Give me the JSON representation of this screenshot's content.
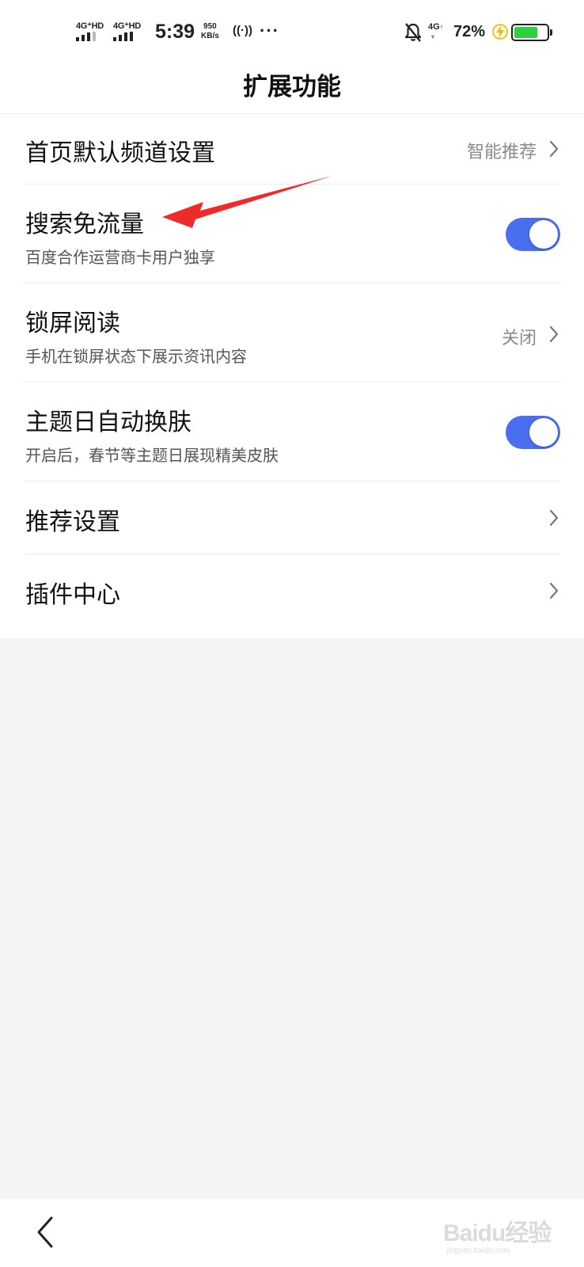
{
  "status_bar": {
    "sim1": "4G⁺HD",
    "sim2": "4G⁺HD",
    "time": "5:39",
    "speed_value": "950",
    "speed_unit": "KB/s",
    "hotspot": "((·))",
    "more": "···",
    "network2": "4G",
    "battery_percent": "72%",
    "battery_level": 0.72,
    "battery_color": "#2fcf3f"
  },
  "header": {
    "title": "扩展功能"
  },
  "settings": {
    "home_channel": {
      "label": "首页默认频道设置",
      "value": "智能推荐"
    },
    "search_free_data": {
      "label": "搜索免流量",
      "desc": "百度合作运营商卡用户独享",
      "enabled": true
    },
    "lock_screen_reading": {
      "label": "锁屏阅读",
      "desc": "手机在锁屏状态下展示资讯内容",
      "value": "关闭"
    },
    "theme_day_skin": {
      "label": "主题日自动换肤",
      "desc": "开启后，春节等主题日展现精美皮肤",
      "enabled": true
    },
    "recommendation": {
      "label": "推荐设置"
    },
    "plugin_center": {
      "label": "插件中心"
    }
  },
  "colors": {
    "toggle_on": "#4a6ef0",
    "annotation_arrow": "#ee2a2a"
  },
  "watermark": {
    "brand": "Baidu经验",
    "url": "jingyan.baidu.com"
  }
}
